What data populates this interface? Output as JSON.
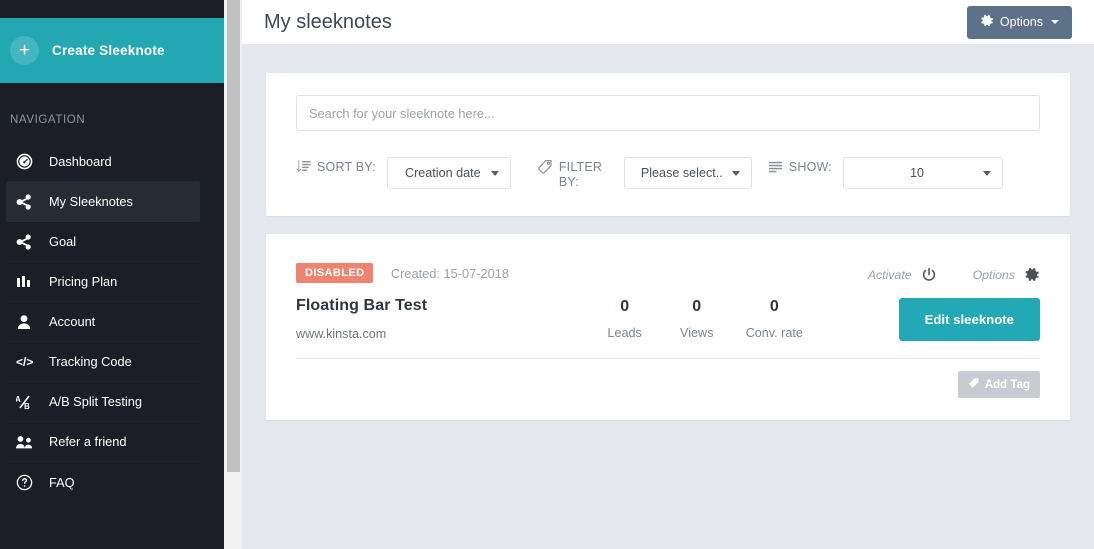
{
  "sidebar": {
    "create": {
      "label": "Create Sleeknote",
      "icon": "plus-icon"
    },
    "nav_title": "NAVIGATION",
    "items": [
      {
        "label": "Dashboard",
        "icon": "dashboard-icon",
        "active": false
      },
      {
        "label": "My Sleeknotes",
        "icon": "share-icon",
        "active": true
      },
      {
        "label": "Goal",
        "icon": "share-icon",
        "active": false
      },
      {
        "label": "Pricing Plan",
        "icon": "bar-chart-icon",
        "active": false
      },
      {
        "label": "Account",
        "icon": "user-icon",
        "active": false
      },
      {
        "label": "Tracking Code",
        "icon": "code-icon",
        "active": false
      },
      {
        "label": "A/B Split Testing",
        "icon": "ab-split-icon",
        "active": false
      },
      {
        "label": "Refer a friend",
        "icon": "users-icon",
        "active": false
      },
      {
        "label": "FAQ",
        "icon": "question-icon",
        "active": false
      }
    ]
  },
  "header": {
    "title": "My sleeknotes",
    "options_label": "Options"
  },
  "filters": {
    "search_placeholder": "Search for your sleeknote here...",
    "search_value": "",
    "sort_label": "SORT BY:",
    "sort_value": "Creation date",
    "filter_label": "FILTER BY:",
    "filter_value": "Please select..",
    "show_label": "SHOW:",
    "show_value": "10"
  },
  "sleeknote": {
    "status_badge": "DISABLED",
    "created": "Created: 15-07-2018",
    "activate_label": "Activate",
    "options_label": "Options",
    "name": "Floating Bar Test",
    "url": "www.kinsta.com",
    "stats": [
      {
        "value": "0",
        "label": "Leads"
      },
      {
        "value": "0",
        "label": "Views"
      },
      {
        "value": "0",
        "label": "Conv. rate"
      }
    ],
    "edit_label": "Edit sleeknote",
    "add_tag_label": "Add Tag"
  },
  "colors": {
    "teal": "#22a7b3",
    "sidebar_bg": "#1b1e26",
    "options_btn": "#5d7289",
    "badge_disabled": "#ee8370",
    "content_bg": "#e4e7ec"
  }
}
